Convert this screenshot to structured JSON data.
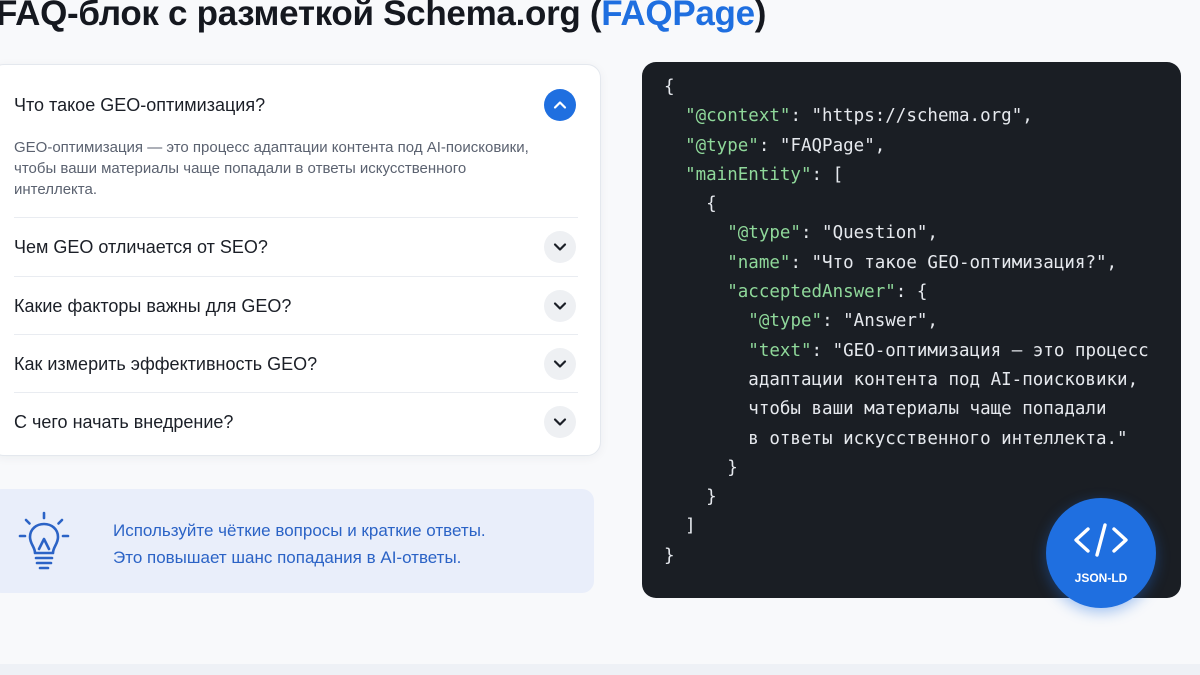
{
  "header": {
    "title_main": "FAQ-блок с разметкой Schema.org (",
    "title_accent": "FAQPage",
    "title_end": ")"
  },
  "faq": {
    "items": [
      {
        "question": "Что такое GEO-оптимизация?",
        "expanded": true,
        "answer_lines": [
          "GEO-оптимизация — это процесс адаптации контента под AI-поисковики,",
          "чтобы ваши материалы чаще попадали в ответы искусственного",
          "интеллекта."
        ]
      },
      {
        "question": "Чем GEO отличается от SEO?",
        "expanded": false
      },
      {
        "question": "Какие факторы важны для GEO?",
        "expanded": false
      },
      {
        "question": "Как измерить эффективность GEO?",
        "expanded": false
      },
      {
        "question": "С чего начать внедрение?",
        "expanded": false
      }
    ]
  },
  "tip": {
    "icon": "lightbulb-icon",
    "line1": "Используйте чёткие вопросы и краткие ответы.",
    "line2": "Это повышает шанс попадания в AI-ответы."
  },
  "code": {
    "lines": [
      "{",
      "  \"@context\": \"https://schema.org\",",
      "  \"@type\": \"FAQPage\",",
      "  \"mainEntity\": [",
      "    {",
      "      \"@type\": \"Question\",",
      "      \"name\": \"Что такое GEO-оптимизация?\",",
      "      \"acceptedAnswer\": {",
      "        \"@type\": \"Answer\",",
      "        \"text\": \"GEO-оптимизация – это процесс",
      "        адаптации контента под AI-поисковики,",
      "        чтобы ваши материалы чаще попадали",
      "        в ответы искусственного интеллекта.\"",
      "      }",
      "    }",
      "  ]",
      "}"
    ]
  },
  "badge": {
    "icon": "code-icon",
    "label": "JSON-LD"
  },
  "colors": {
    "accent": "#1f6fe0",
    "code_bg": "#1a1e24",
    "code_key": "#8fd89a",
    "tip_bg": "#e9eefa"
  }
}
